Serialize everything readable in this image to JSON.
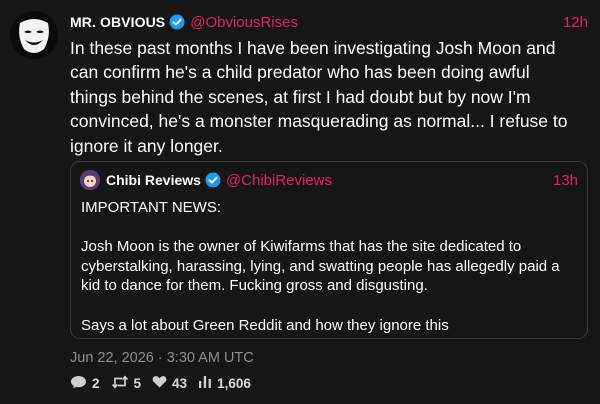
{
  "tweet": {
    "author_name": "MR. OBVIOUS",
    "handle": "@ObviousRises",
    "time": "12h",
    "text": "In these past months I have been investigating Josh Moon and\ncan confirm he's a child predator who has been doing awful\nthings behind the scenes, at first I had doubt but by now I'm\nconvinced, he's a monster masquerading as normal... I refuse to\nignore it any longer.",
    "date": "Jun 22, 2026 · 3:30 AM UTC",
    "stats": {
      "replies": "2",
      "retweets": "5",
      "likes": "43",
      "views": "1,606"
    }
  },
  "quoted": {
    "author_name": "Chibi Reviews",
    "handle": "@ChibiReviews",
    "time": "13h",
    "text": "IMPORTANT NEWS:\n\nJosh Moon is the owner of Kiwifarms that has the site dedicated to\ncyberstalking, harassing, lying, and swatting people has allegedly paid a\nkid to dance for them. Fucking gross and disgusting.\n\nSays a lot about Green Reddit and how they ignore this"
  },
  "colors": {
    "background": "#161616",
    "accent": "#e0245e",
    "verified": "#1d9bf0",
    "muted": "#8e8e8e"
  },
  "icons": [
    "verified-badge-icon",
    "reply-icon",
    "retweet-icon",
    "like-icon",
    "views-icon"
  ]
}
